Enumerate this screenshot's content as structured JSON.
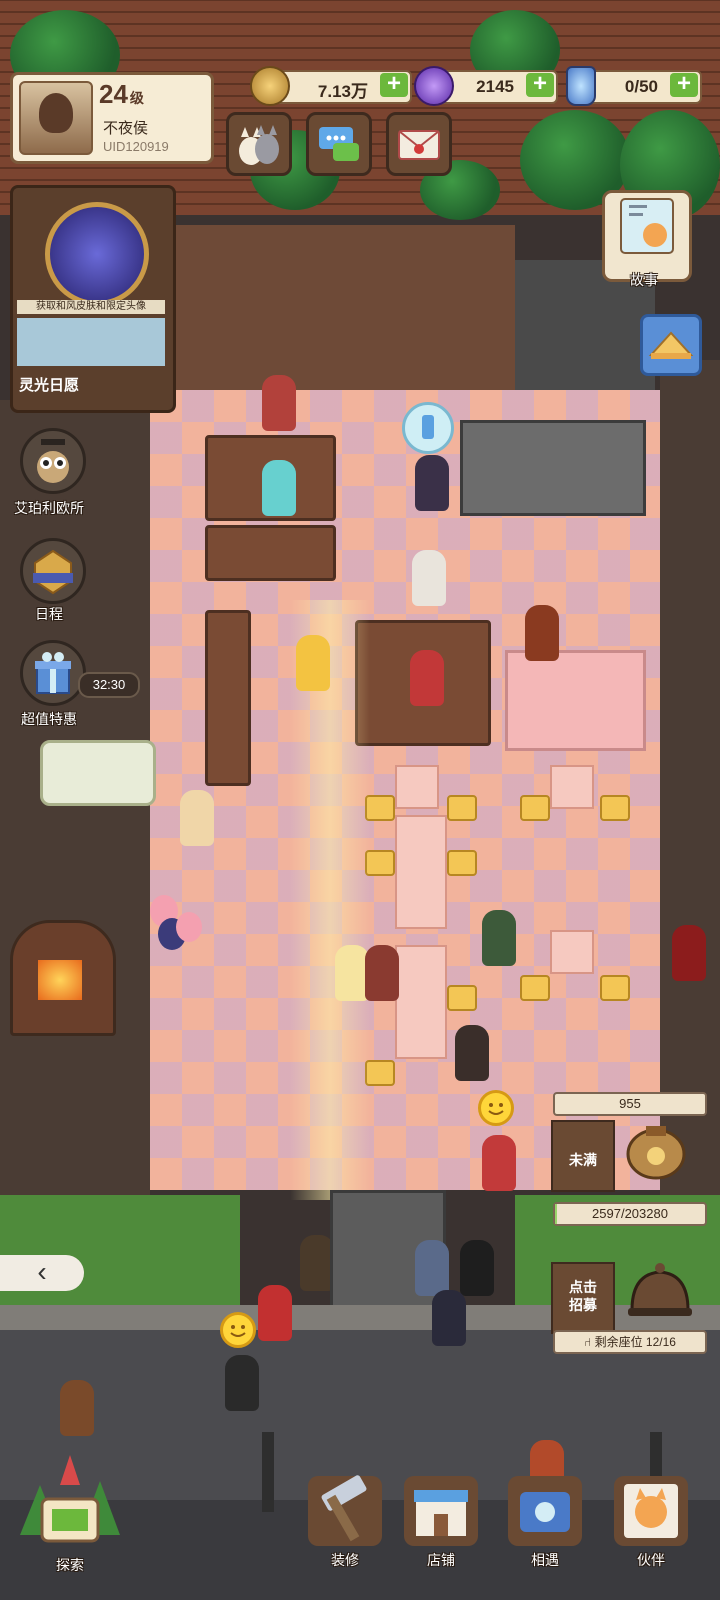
{
  "player": {
    "level": "24",
    "level_suffix": "级",
    "name": "不夜侯",
    "uid": "UID120919"
  },
  "resources": [
    {
      "name": "coins",
      "icon": "coin-icon",
      "value": "7.13万"
    },
    {
      "name": "gems",
      "icon": "gem-icon",
      "value": "2145"
    },
    {
      "name": "potion",
      "icon": "potion-icon",
      "value": "0/50"
    }
  ],
  "top_buttons": [
    {
      "name": "cats",
      "icon": "cat-icon"
    },
    {
      "name": "chat",
      "icon": "chat-icon"
    },
    {
      "name": "mail",
      "icon": "mail-icon"
    }
  ],
  "event": {
    "tag": "获取和风皮肤和限定头像",
    "title": "灵光日愿"
  },
  "side_menu": [
    {
      "label": "艾珀利欧所",
      "icon": "owl-icon"
    },
    {
      "label": "日程",
      "icon": "schedule-icon"
    },
    {
      "label": "超值特惠",
      "icon": "gift-icon"
    }
  ],
  "deal_timer": "32:30",
  "story": {
    "label": "故事"
  },
  "shop_info": {
    "popularity": "955",
    "status": "未满",
    "progress_text": "2597/203280",
    "progress_fraction": 0.0128,
    "recruit_label": "点击招募",
    "seats": "剩余座位 12/16"
  },
  "bottom_nav": [
    {
      "label": "探索",
      "icon": "explore-icon"
    },
    {
      "label": "装修",
      "icon": "hammer-icon"
    },
    {
      "label": "店铺",
      "icon": "shop-icon"
    },
    {
      "label": "相遇",
      "icon": "phone-icon"
    },
    {
      "label": "伙伴",
      "icon": "partner-icon"
    }
  ],
  "colors": {
    "accent_green": "#6cb83c",
    "panel_brown": "#6a4a33",
    "frame_cream": "#f3e7cc",
    "smile_yellow": "#ffd63a"
  }
}
